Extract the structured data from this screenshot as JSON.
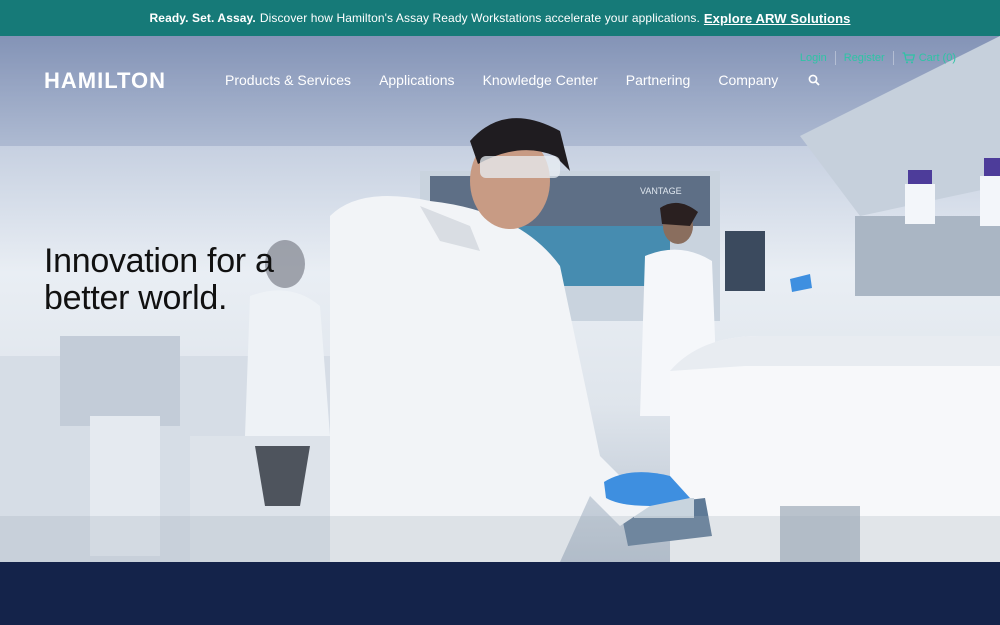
{
  "announcement": {
    "lead": "Ready. Set. Assay.",
    "message": "Discover how Hamilton's Assay Ready Workstations accelerate your applications.",
    "link": "Explore ARW Solutions"
  },
  "header": {
    "logo_text": "HAMILTON",
    "nav": [
      "Products & Services",
      "Applications",
      "Knowledge Center",
      "Partnering",
      "Company"
    ],
    "search_icon": "search-icon",
    "utility": {
      "login": "Login",
      "register": "Register",
      "cart": "Cart (0)"
    }
  },
  "hero": {
    "headline": "Innovation for a better world.",
    "instrument_label": "VANTAGE"
  },
  "colors": {
    "announcement_bg": "#167a78",
    "utility_link": "#2ec4a5",
    "footer_band": "#14234a"
  }
}
